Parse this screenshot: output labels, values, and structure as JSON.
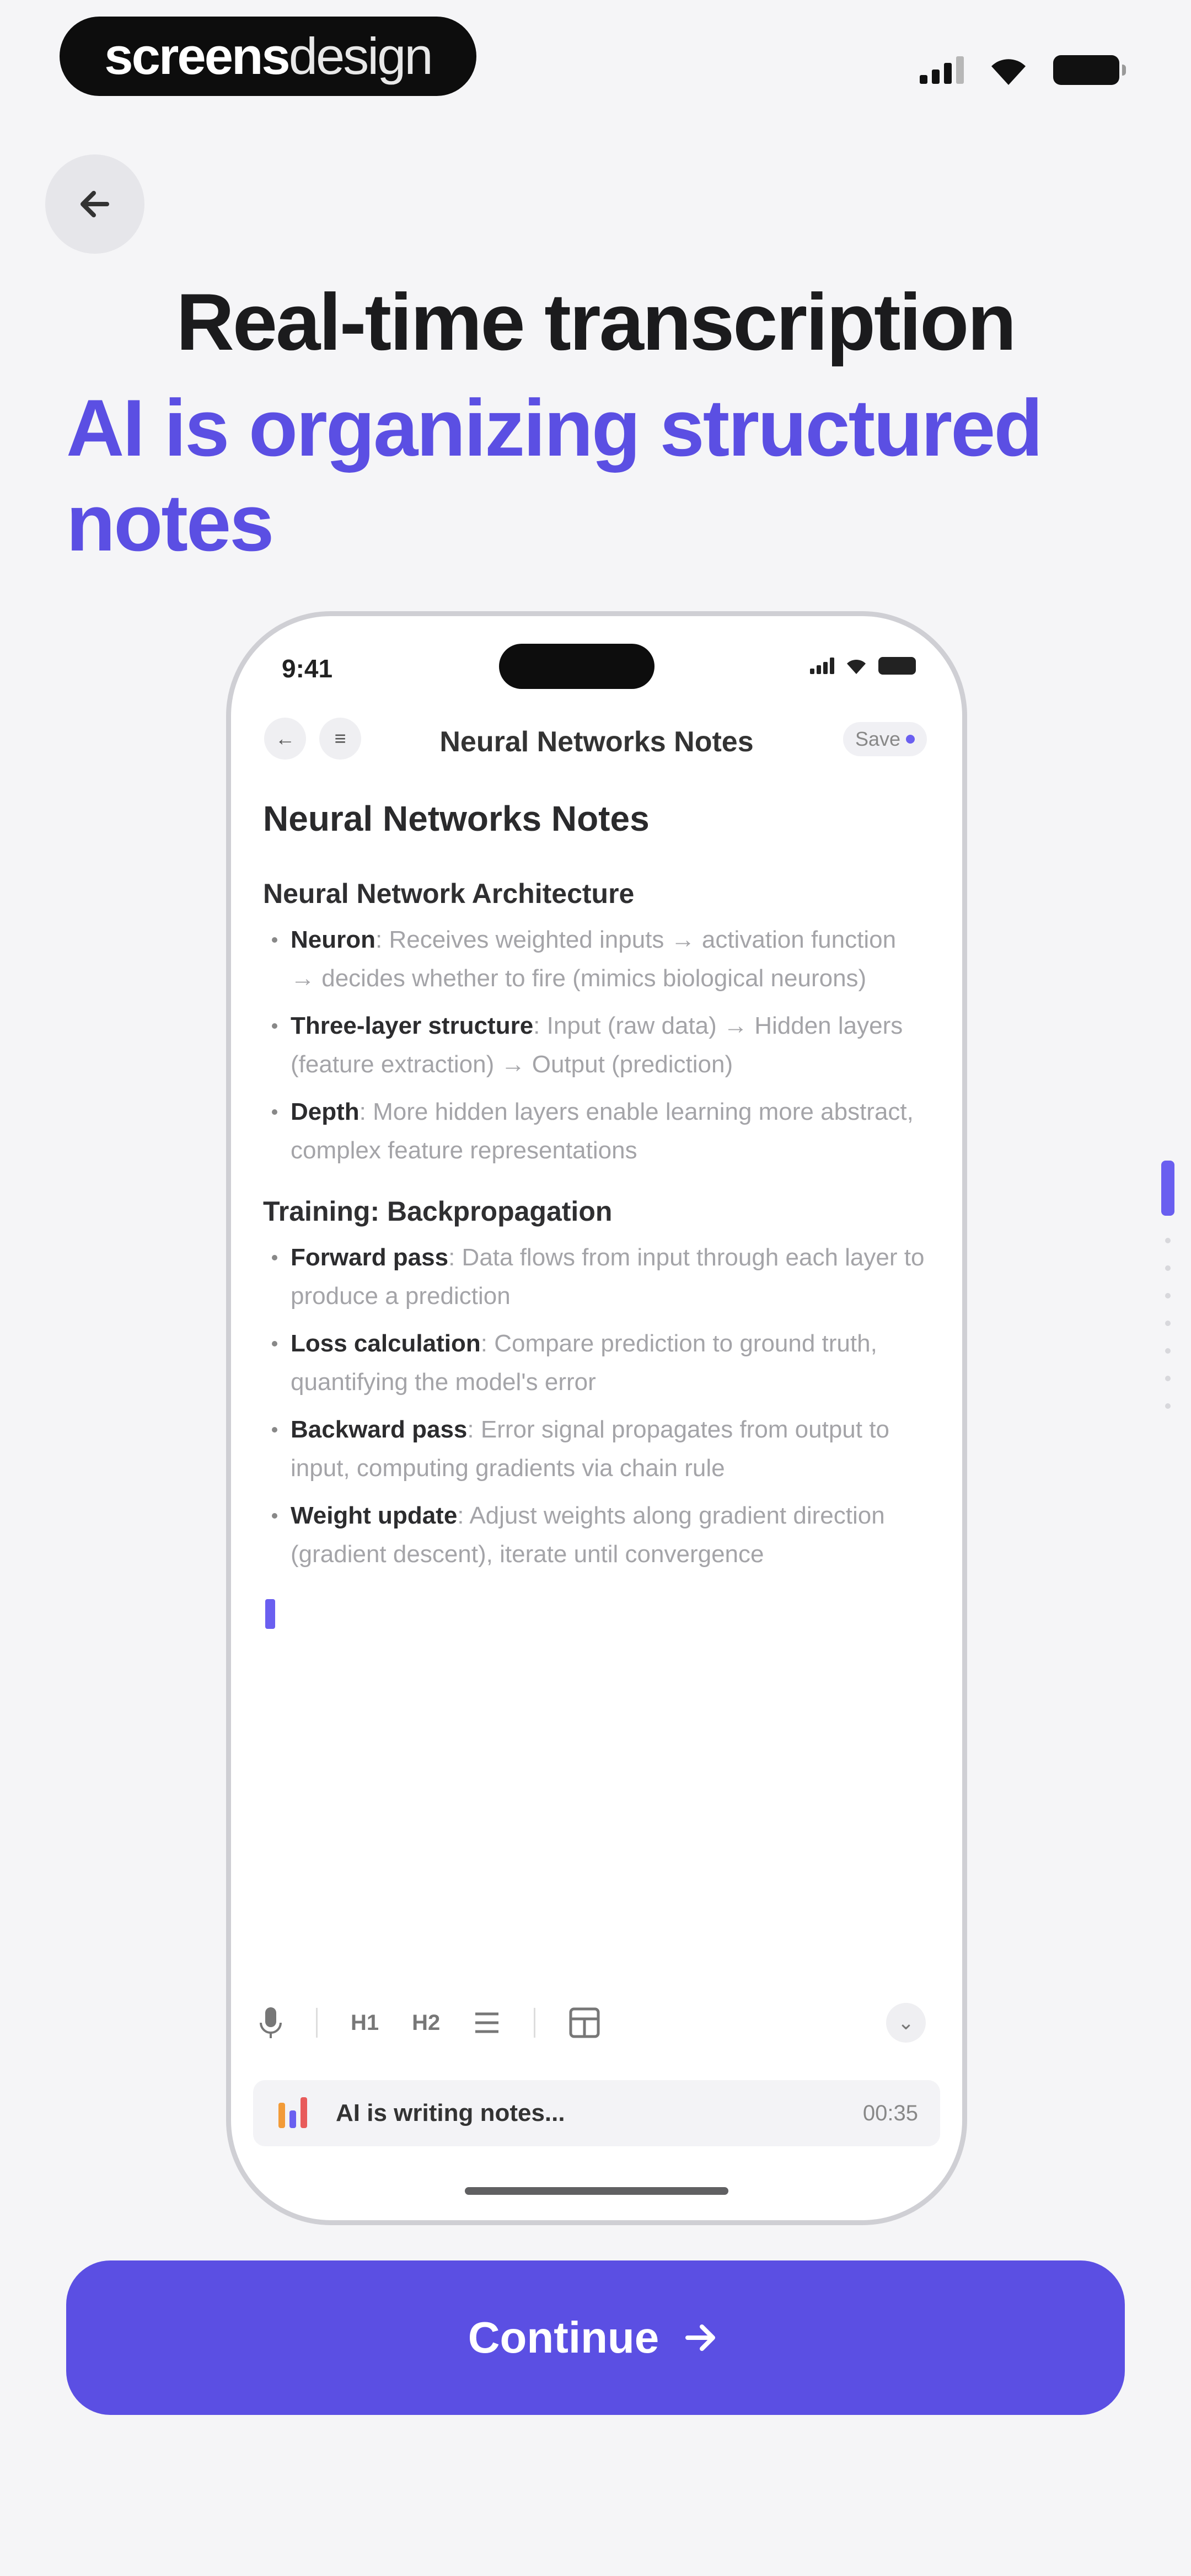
{
  "status_bar": {
    "brand_part1": "screens",
    "brand_part2": "design"
  },
  "header": {
    "title": "Real-time transcription",
    "subtitle": "AI is organizing structured notes"
  },
  "phone": {
    "time": "9:41",
    "nav_title": "Neural Networks Notes",
    "save_label": "Save",
    "doc_title": "Neural Networks Notes",
    "sections": [
      {
        "heading": "Neural Network Architecture",
        "items": [
          {
            "term": "Neuron",
            "text": ": Receives weighted inputs → activation function → decides whether to fire (mimics biological neurons)"
          },
          {
            "term": "Three-layer structure",
            "text": ": Input (raw data) → Hidden layers (feature extraction) → Output (prediction)"
          },
          {
            "term": "Depth",
            "text": ": More hidden layers enable learning more abstract, complex feature representations"
          }
        ]
      },
      {
        "heading": "Training: Backpropagation",
        "items": [
          {
            "term": "Forward pass",
            "text": ": Data flows from input through each layer to produce a prediction"
          },
          {
            "term": "Loss calculation",
            "text": ": Compare prediction to ground truth, quantifying the model's error"
          },
          {
            "term": "Backward pass",
            "text": ": Error signal propagates from output to input, computing gradients via chain rule"
          },
          {
            "term": "Weight update",
            "text": ": Adjust weights along gradient direction (gradient descent), iterate until convergence"
          }
        ]
      }
    ],
    "toolbar": {
      "h1": "H1",
      "h2": "H2"
    },
    "ai_status": "AI is writing notes...",
    "ai_timer": "00:35"
  },
  "cta": {
    "continue_label": "Continue"
  },
  "colors": {
    "accent": "#5b4fe3",
    "background": "#f5f5f7"
  }
}
